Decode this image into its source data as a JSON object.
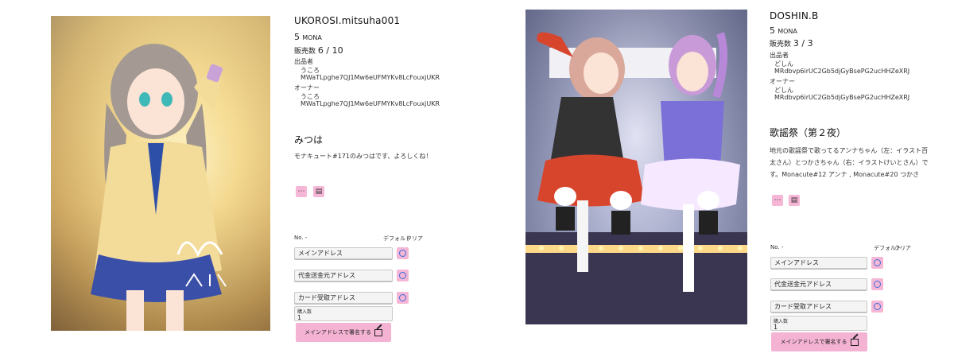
{
  "cards": [
    {
      "title": "UKOROSI.mitsuha001",
      "price": "5",
      "currency": "MONA",
      "sold_label": "販売数",
      "sold_value": "6 / 10",
      "publisher_label": "出品者",
      "publisher_name": "うころ",
      "publisher_address": "MWaTLpghe7QJ1Mw6eUFMYKv8LcFouxjUKR",
      "owner_label": "オーナー",
      "owner_name": "うころ",
      "owner_address": "MWaTLpghe7QJ1Mw6eUFMYKv8LcFouxjUKR",
      "subtitle": "みつは",
      "description": "モナキュート#171のみつはです、よろしくね！",
      "more_icon": "ellipsis-icon",
      "doc_icon": "document-icon",
      "no_label": "No. -",
      "default_label": "デフォルト",
      "clear_label": "クリア",
      "fields": [
        "メインアドレス",
        "代金送金元アドレス",
        "カード受取アドレス"
      ],
      "qty_label": "購入数",
      "qty_value": "1",
      "sign_label": "メインアドレスで署名する"
    },
    {
      "title": "DOSHIN.B",
      "price": "5",
      "currency": "MONA",
      "sold_label": "販売数",
      "sold_value": "3 / 3",
      "publisher_label": "出品者",
      "publisher_name": "どしん",
      "publisher_address": "MRdbvp6irUC2Gb5djGyBsePG2ucHHZeXRJ",
      "owner_label": "オーナー",
      "owner_name": "どしん",
      "owner_address": "MRdbvp6irUC2Gb5djGyBsePG2ucHHZeXRJ",
      "subtitle": "歌謡祭（第２夜）",
      "description_lines": [
        "地元の歌謡祭で歌ってるアンナちゃん（左：イラスト百",
        "太さん）とつかさちゃん（右：イラストけいとさん）で",
        "す。Monacute#12 アンナ , Monacute#20 つかさ"
      ],
      "more_icon": "ellipsis-icon",
      "doc_icon": "document-icon",
      "no_label": "No. -",
      "default_label": "デフォルト",
      "clear_label": "クリア",
      "fields": [
        "メインアドレス",
        "代金送金元アドレス",
        "カード受取アドレス"
      ],
      "qty_label": "購入数",
      "qty_value": "1",
      "sign_label": "メインアドレスで署名する"
    }
  ]
}
